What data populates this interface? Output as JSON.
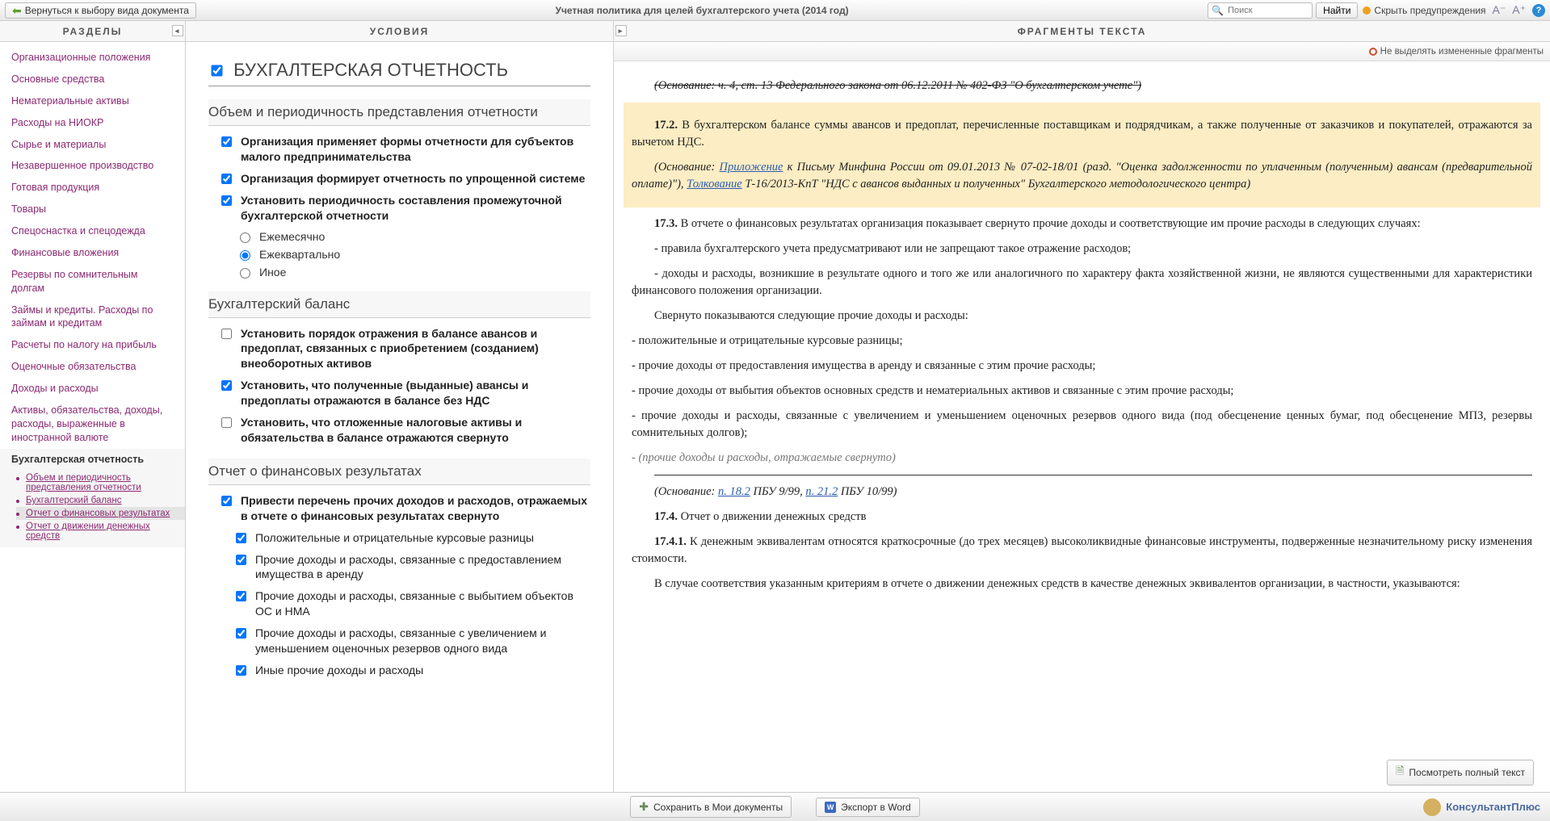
{
  "top": {
    "back": "Вернуться к выбору вида документа",
    "title": "Учетная политика для целей бухгалтерского учета (2014 год)",
    "search_ph": "Поиск",
    "find": "Найти",
    "hide_warn": "Скрыть предупреждения"
  },
  "headers": {
    "left": "РАЗДЕЛЫ",
    "mid": "УСЛОВИЯ",
    "right": "ФРАГМЕНТЫ ТЕКСТА"
  },
  "sidebar": {
    "items": [
      "Организационные положения",
      "Основные средства",
      "Нематериальные активы",
      "Расходы на НИОКР",
      "Сырье и материалы",
      "Незавершенное производство",
      "Готовая продукция",
      "Товары",
      "Спецоснастка и спецодежда",
      "Финансовые вложения",
      "Резервы по сомнительным долгам",
      "Займы и кредиты. Расходы по займам и кредитам",
      "Расчеты по налогу на прибыль",
      "Оценочные обязательства",
      "Доходы и расходы",
      "Активы, обязательства, доходы, расходы, выраженные в иностранной валюте"
    ],
    "active": "Бухгалтерская отчетность",
    "subs": [
      "Объем и периодичность представления отчетности",
      "Бухгалтерский баланс",
      "Отчет о финансовых результатах",
      "Отчет о движении денежных средств"
    ]
  },
  "cond": {
    "h1": "БУХГАЛТЕРСКАЯ ОТЧЕТНОСТЬ",
    "s1": {
      "title": "Объем и периодичность представления отчетности",
      "o1": "Организация применяет формы отчетности для субъектов малого предпринимательства",
      "o2": "Организация формирует отчетность по упрощенной системе",
      "o3": "Установить периодичность составления промежуточной бухгалтерской отчетности",
      "r1": "Ежемесячно",
      "r2": "Ежеквартально",
      "r3": "Иное"
    },
    "s2": {
      "title": "Бухгалтерский баланс",
      "o1": "Установить порядок отражения в балансе авансов и предоплат, связанных с приобретением (созданием) внеоборотных активов",
      "o2": "Установить, что полученные (выданные) авансы и предоплаты отражаются в балансе без НДС",
      "o3": "Установить, что отложенные налоговые активы и обязательства в балансе отражаются свернуто"
    },
    "s3": {
      "title": "Отчет о финансовых результатах",
      "o1": "Привести перечень прочих доходов и расходов, отражаемых в отчете о финансовых результатах свернуто",
      "c1": "Положительные и отрицательные курсовые разницы",
      "c2": "Прочие доходы и расходы, связанные с предоставлением имущества в аренду",
      "c3": "Прочие доходы и расходы, связанные с выбытием объектов ОС и НМА",
      "c4": "Прочие доходы и расходы, связанные с увеличением и уменьшением оценочных резервов одного вида",
      "c5": "Иные прочие доходы и расходы"
    }
  },
  "frag": {
    "toolbar": "Не выделять измененные фрагменты",
    "top_cut": "(Основание: ч. 4, ст. 13 Федерального закона от 06.12.2011 № 402-ФЗ \"О бухгалтерском учете\")",
    "p172_a": "17.2.",
    "p172_b": " В бухгалтерском балансе суммы авансов и предоплат, перечисленные поставщикам и подрядчикам, а также полученные от заказчиков и покупателей, отражаются за вычетом НДС.",
    "p172_base1": "(Основание: ",
    "p172_link1": "Приложение",
    "p172_base2": " к Письму Минфина России от 09.01.2013 № 07-02-18/01 (разд. \"Оценка задолженности по уплаченным (полученным) авансам (предварительной оплате)\"), ",
    "p172_link2": "Толкование",
    "p172_base3": " Т-16/2013-КпТ \"НДС с авансов выданных и полученных\" Бухгалтерского методологического центра)",
    "p173_a": "17.3.",
    "p173_b": " В отчете о финансовых результатах организация показывает свернуто прочие доходы и соответствующие им прочие расходы в следующих случаях:",
    "p173_l1": "- правила бухгалтерского учета предусматривают или не запрещают такое отражение расходов;",
    "p173_l2": "- доходы и расходы, возникшие в результате одного и того же или аналогичного по характеру факта хозяйственной жизни, не являются существенными для характеристики финансового положения организации.",
    "p173_s": "Свернуто показываются следующие прочие доходы и расходы:",
    "b1": "- положительные и отрицательные курсовые разницы;",
    "b2": "- прочие доходы от предоставления имущества в аренду и связанные с этим прочие расходы;",
    "b3": "- прочие доходы от выбытия объектов основных средств и нематериальных активов и связанные с этим прочие расходы;",
    "b4": "- прочие доходы и расходы, связанные с увеличением и уменьшением оценочных резервов одного вида (под обесценение ценных бумаг, под обесценение МПЗ, резервы сомнительных долгов);",
    "b5": "- (прочие доходы и расходы, отражаемые свернуто)",
    "base2_a": "(Основание: ",
    "base2_l1": "п. 18.2",
    "base2_b": " ПБУ 9/99, ",
    "base2_l2": "п. 21.2",
    "base2_c": " ПБУ 10/99)",
    "p174_a": "17.4.",
    "p174_b": " Отчет о движении денежных средств",
    "p1741_a": "17.4.1.",
    "p1741_b": " К денежным эквивалентам относятся краткосрочные (до трех месяцев) высоколиквидные финансовые инструменты, подверженные незначительному риску изменения стоимости.",
    "p1741_c": "В случае соответствия указанным критериям в отчете о движении денежных средств в качестве денежных эквивалентов организации, в частности, указываются:",
    "fullbtn": "Посмотреть полный текст"
  },
  "bottom": {
    "save": "Сохранить в Мои документы",
    "export": "Экспорт в Word",
    "brand": "КонсультантПлюс"
  }
}
